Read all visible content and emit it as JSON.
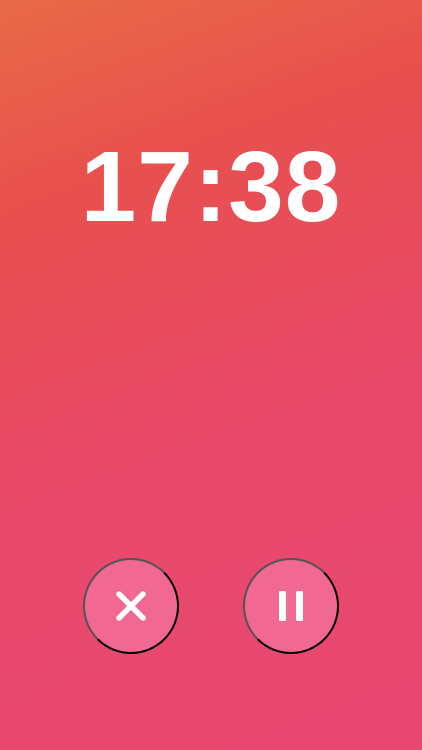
{
  "timer": {
    "display": "17:38"
  },
  "controls": {
    "cancel": {
      "icon": "close-icon"
    },
    "pause": {
      "icon": "pause-icon"
    }
  },
  "colors": {
    "background_top": "#E86A46",
    "background_mid": "#E8504E",
    "background_bottom": "#E84872",
    "button_fill": "#F16892",
    "foreground": "#FFFFFF"
  }
}
